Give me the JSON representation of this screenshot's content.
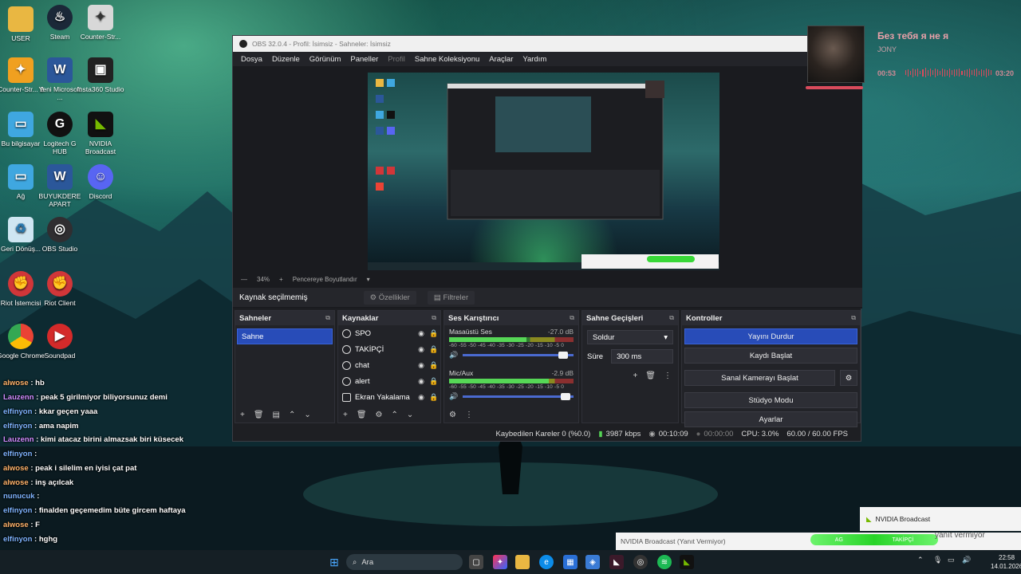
{
  "desktop": {
    "icons": [
      {
        "label": "USER"
      },
      {
        "label": "Steam"
      },
      {
        "label": "Counter-Str..."
      },
      {
        "label": "Counter-Str... 2"
      },
      {
        "label": "Yeni Microsoft ..."
      },
      {
        "label": "Insta360 Studio"
      },
      {
        "label": "Bu bilgisayar"
      },
      {
        "label": "Logitech G HUB"
      },
      {
        "label": "NVIDIA Broadcast"
      },
      {
        "label": "Ağ"
      },
      {
        "label": "BUYUKDERE APART"
      },
      {
        "label": "Discord"
      },
      {
        "label": "Geri Dönüş..."
      },
      {
        "label": "OBS Studio"
      },
      {
        "label": "Riot İstemcisi"
      },
      {
        "label": "Riot Client"
      },
      {
        "label": "Google Chrome"
      },
      {
        "label": "Soundpad"
      }
    ]
  },
  "chat": [
    {
      "user": "alwose",
      "text": "hb"
    },
    {
      "user": "Lauzenn",
      "text": "peak 5 girilmiyor biliyorsunuz demi"
    },
    {
      "user": "elfinyon",
      "text": "kkar geçen yaaa"
    },
    {
      "user": "elfinyon",
      "text": "ama napim"
    },
    {
      "user": "Lauzenn",
      "text": "kimi atacaz birini almazsak biri küsecek"
    },
    {
      "user": "elfinyon",
      "text": ":"
    },
    {
      "user": "alwose",
      "text": "peak i silelim en iyisi çat pat"
    },
    {
      "user": "alwose",
      "text": "inş açılcak"
    },
    {
      "user": "nunucuk",
      "text": ""
    },
    {
      "user": "elfinyon",
      "text": "finalden geçemedim büte gircem haftaya"
    },
    {
      "user": "alwose",
      "text": "F"
    },
    {
      "user": "elfinyon",
      "text": "hghg"
    }
  ],
  "obs": {
    "title": "OBS 32.0.4 - Profil: İsimsiz - Sahneler: İsimsiz",
    "menu": [
      "Dosya",
      "Düzenle",
      "Görünüm",
      "Paneller",
      "Profil",
      "Sahne Koleksiyonu",
      "Araçlar",
      "Yardım"
    ],
    "zoom": "34%",
    "fit_label": "Pencereye Boyutlandır",
    "no_source": "Kaynak seçilmemiş",
    "properties_btn": "Özellikler",
    "filters_btn": "Filtreler",
    "scenes": {
      "title": "Sahneler",
      "items": [
        "Sahne"
      ]
    },
    "sources": {
      "title": "Kaynaklar",
      "items": [
        "SPO",
        "TAKİPÇİ",
        "chat",
        "alert",
        "Ekran Yakalama"
      ]
    },
    "mixer": {
      "title": "Ses Karıştırıcı",
      "scale": "-60 -55 -50 -45 -40 -35 -30 -25 -20 -15 -10 -5 0",
      "channels": [
        {
          "name": "Masaüstü Ses",
          "db": "-27.0 dB",
          "level": 0.62,
          "volume": 0.95
        },
        {
          "name": "Mic/Aux",
          "db": "-2.9 dB",
          "level": 0.8,
          "volume": 0.97
        }
      ]
    },
    "transitions": {
      "title": "Sahne Geçişleri",
      "selected": "Soldur",
      "duration_label": "Süre",
      "duration": "300 ms"
    },
    "controls": {
      "title": "Kontroller",
      "buttons": [
        "Yayını Durdur",
        "Kaydı Başlat",
        "Sanal Kamerayı Başlat",
        "Stüdyo Modu",
        "Ayarlar"
      ]
    },
    "status": {
      "dropped": "Kaybedilen Kareler 0 (%0.0)",
      "bitrate": "3987 kbps",
      "stream_time": "00:10:09",
      "rec_time": "00:00:00",
      "cpu": "CPU: 3.0%",
      "fps": "60.00 / 60.00 FPS"
    }
  },
  "music": {
    "song": "Без тебя я не я",
    "artist": "JONY",
    "elapsed": "00:53",
    "total": "03:20"
  },
  "notifications": {
    "nvidia_title": "NVIDIA Broadcast",
    "nvidia_status": "NVIDIA Broadcast (Yanıt Vermiyor)",
    "nvidia_right": "yanıt vermiyor",
    "green_left": "AG",
    "green_right": "TAKİPÇİ"
  },
  "taskbar": {
    "search_placeholder": "Ara",
    "time": "22:58",
    "date": "14.01.2026"
  }
}
